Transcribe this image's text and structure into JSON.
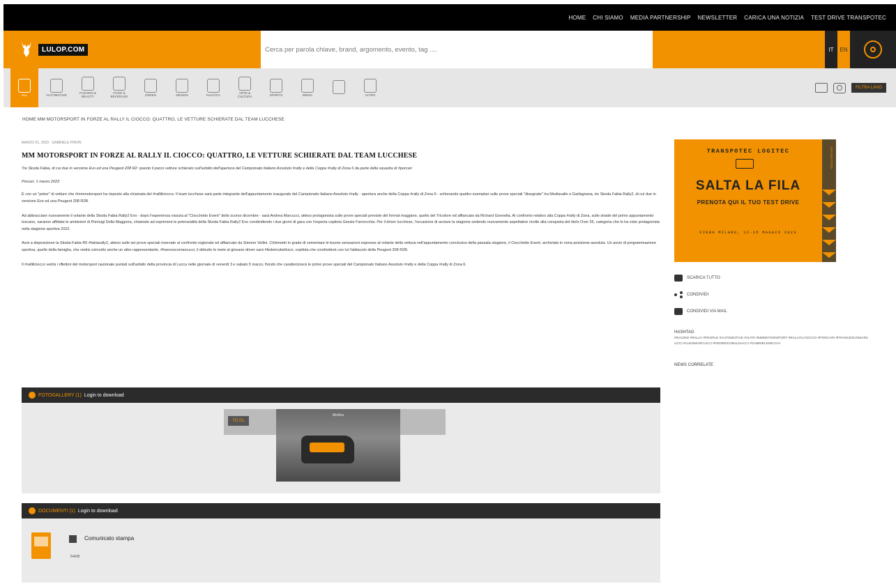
{
  "topnav": [
    "HOME",
    "CHI SIAMO",
    "MEDIA PARTNERSHIP",
    "NEWSLETTER",
    "CARICA UNA NOTIZIA",
    "TEST DRIVE TRANSPOTEC"
  ],
  "header": {
    "logo_text": "LULOP.COM",
    "search_placeholder": "Cerca per parola chiave, brand, argomento, evento, tag ....",
    "lang_it": "IT",
    "lang_en": "EN"
  },
  "categories": [
    {
      "label": "ALL",
      "icon": "all-icon",
      "active": true
    },
    {
      "label": "AUTOMOTIVE",
      "icon": "car-icon"
    },
    {
      "label": "FASHION & BEAUTY",
      "icon": "fashion-icon"
    },
    {
      "label": "FOOD & BEVERAGE",
      "icon": "food-icon"
    },
    {
      "label": "GREEN",
      "icon": "green-icon"
    },
    {
      "label": "DESIGN",
      "icon": "design-icon"
    },
    {
      "label": "NAUTICA",
      "icon": "nautica-icon"
    },
    {
      "label": "ARTE & CULTURA",
      "icon": "art-icon"
    },
    {
      "label": "SPORTS",
      "icon": "sports-icon"
    },
    {
      "label": "MEDIA",
      "icon": "media-icon"
    },
    {
      "label": "",
      "icon": "wine-icon"
    },
    {
      "label": "ALTRO",
      "icon": "altro-icon"
    }
  ],
  "filter_label": "FILTRA LANG",
  "breadcrumb": "HOME MM MOTORSPORT IN FORZE AL RALLY IL CIOCCO: QUATTRO, LE VETTURE SCHIERATE DAL TEAM LUCCHESE",
  "article": {
    "meta": "MARZO 01, 2023 · GABRIELE PIRON",
    "title": "MM MOTORSPORT IN FORZE AL RALLY IL CIOCCO: QUATTRO, LE VETTURE SCHIERATE DAL TEAM LUCCHESE",
    "lead": "Tre Skoda Fabia, di cui due in versione Evo ed una Peugeot 208 R2: questo il parco vetture schierato sull'asfalto dell'apertura del Campionato Italiano Assoluto #rally e della Coppa #rally di Zona 6 da parte della squadra di #porcari",
    "place": "Porcari, 1 marzo 2023",
    "paragraphs": [
      "È con un \"poker\" di vetture che #mmmotorsport ha risposto alla chiamata del #ralliilciocco. Il team lucchese sarà parte integrante dell'appuntamento inaugurale del Campionato Italiano Assoluto #rally - apertura anche della Coppa #rally di Zona 6 - schierando quattro esemplari sulle prove speciali \"disegnate\" tra Mediavalle e Garfagnana, tre Skoda Fabia Rally2, di cui due in versione Evo ed una Peugeot 208 R2B.",
      "Ad abbracciare nuovamente il volante della Skoda Fabia Rally2 Evo - dopo l'esperienza vissuta al \"Ciocchetto Event\" dello scorso dicembre - sarà Andrea Marcucci, atteso protagonista sulle prove speciali previste del format maggiore, quello del Tricolore ed affiancato da Richard Gonnella. Al confronto relativo alla Coppa #rally di Zona, sulle strade del primo appuntamento toscano, saranno affidate le ambizioni di Pierluigi Della Maggiora, chiamato ad esprimere le potenzialità della Skoda Fabia Rally2 Evo condividendo i due giorni di gara con l'esperta copilota Gessie Farnocchia. Per il driver lucchese, l'occasione di avviare la stagione sedendo nuovamente aspettative rivolte alla conquista del titolo Over 55, categoria che lo ha visto protagonista nella stagione sportiva 2022.",
      "Avrà a disposizione la Skoda Fabia R5 #fabiarally2, atteso sulle sei prove speciali riservate al confronto regionale ed affiancato da Simone Vellini. Chilometri in grado di cementare le buone sensazioni espresse al volante della vettura nell'appuntamento conclusivo della passata stagione, il Ciocchetto Event, archiviato in nona posizione assoluta. Un avvio di programmazione sportiva, quello della famiglia, che vedrà coinvolto anche un altro rappresentante, #francescomarcucci, il debutto le mete al giovane driver sarà #federicobellucci, copilota che condividerà con lui l'abitacolo della Peugeot 208 R2B.",
      "Il #ralliilciocco vedrà i riflettori del motorsport nazionale puntati sull'asfalto della provincia di Lucca nelle giornate di venerdì 3 e sabato 5 marzo, fiondo che caratterizzerà le prime prove speciali del Campionato Italiano Assoluto #rally e della Coppa #rally di Zona 6."
    ]
  },
  "gallery": {
    "name": "FOTOGALLERY (1)",
    "login": "Login to download",
    "tag": "TO DL",
    "photo_caption": "Modica"
  },
  "documents": {
    "name": "DOCUMENTI (1)",
    "login": "Login to download",
    "doc_title": "Comunicato stampa",
    "doc_size": "54KB"
  },
  "sidebar": {
    "ad_top": "TRANSPOTEC LOGITEC",
    "ad_main": "SALTA LA FILA",
    "ad_sub": "PRENOTA QUI IL TUO TEST DRIVE",
    "ad_date": "FIERA MILANO, 12-15 MAGGIO 2023",
    "ad_stripe": "MEDIA PARTNER",
    "download_all": "SCARICA TUTTO",
    "share": "CONDIVIDI",
    "share_mail": "CONDIVIDI VIA MAIL",
    "hashtag_title": "HASHTAG",
    "hashtags": "#RACING #RALLY #PEOPLE #AUTOMOTIVE #AUTO #MMMOTORSPORT #RALLYILCIOCCO #PORCARI #FRANCESCOMARCUCCI #LUIGIMARCUCCI #FEDERICOBALDACCI #GABRIELEMICCHI",
    "news_title": "NEWS CORRELATE"
  }
}
